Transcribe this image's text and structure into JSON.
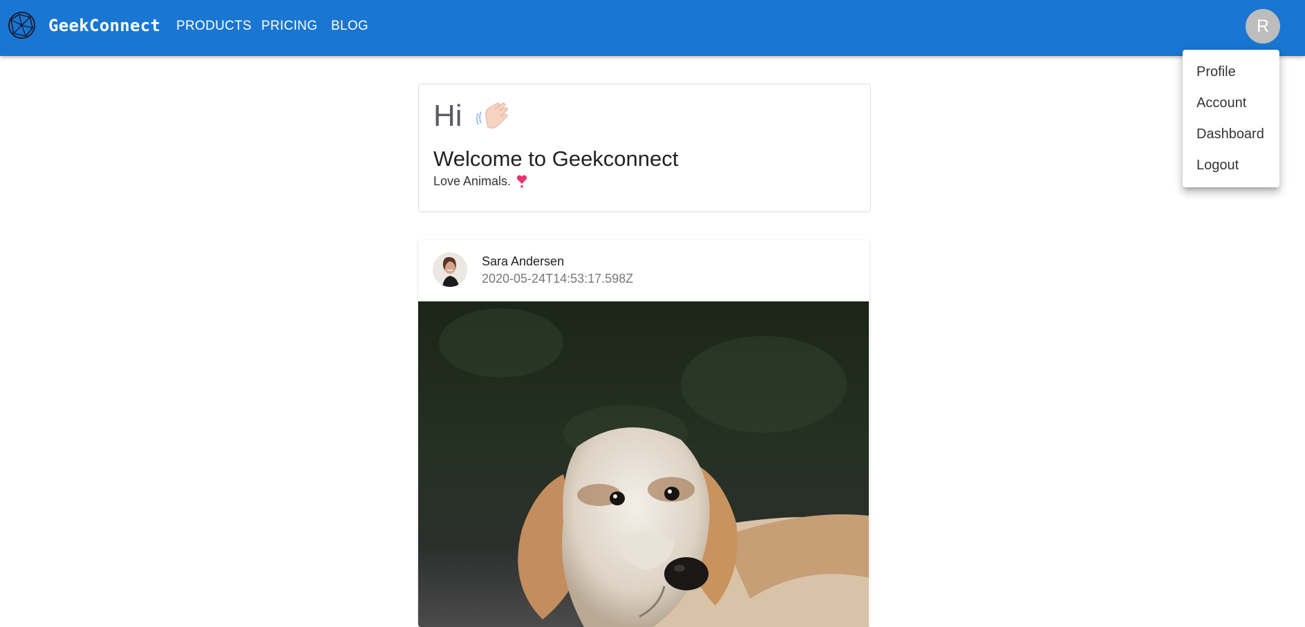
{
  "header": {
    "brand": "GeekConnect",
    "nav": [
      "PRODUCTS",
      "PRICING",
      "BLOG"
    ],
    "avatar_initial": "R",
    "logo_icon": "globe-network-logo",
    "bar_color": "#1976d2"
  },
  "user_menu": {
    "items": [
      "Profile",
      "Account",
      "Dashboard",
      "Logout"
    ]
  },
  "welcome_card": {
    "greeting": "Hi",
    "greeting_icon": "waving-hand-icon",
    "title": "Welcome to Geekconnect",
    "tagline": "Love Animals.",
    "tagline_icon": "heart-exclamation-icon"
  },
  "post": {
    "author": "Sara Andersen",
    "timestamp": "2020-05-24T14:53:17.598Z",
    "image_subject": "dog-photo"
  }
}
